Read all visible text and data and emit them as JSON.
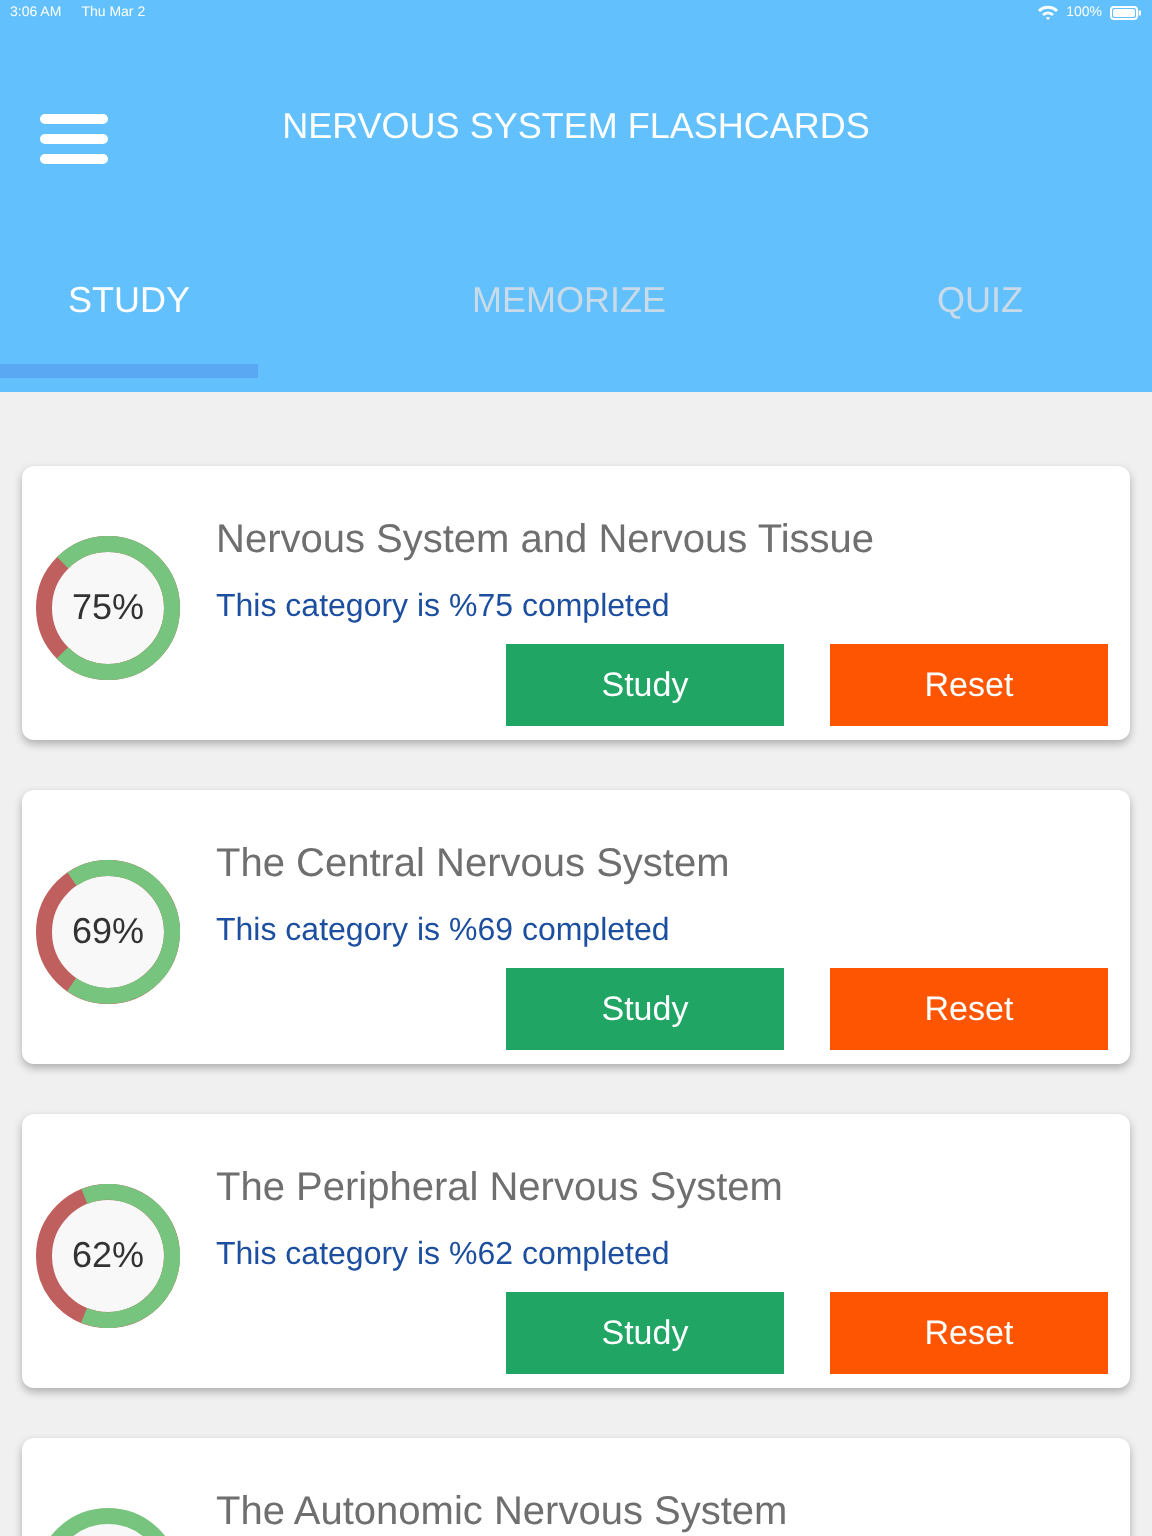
{
  "status_bar": {
    "time": "3:06 AM",
    "date": "Thu Mar 2",
    "battery": "100%"
  },
  "header": {
    "title": "NERVOUS SYSTEM FLASHCARDS"
  },
  "tabs": [
    {
      "label": "STUDY",
      "selected": true
    },
    {
      "label": "MEMORIZE",
      "selected": false
    },
    {
      "label": "QUIZ",
      "selected": false
    }
  ],
  "categories": [
    {
      "title": "Nervous System and Nervous Tissue",
      "percent": "75%",
      "level": 0.75,
      "subtitle": "This category is %75 completed",
      "buttons": [
        "Study",
        "Reset"
      ]
    },
    {
      "title": "The Central Nervous System",
      "percent": "69%",
      "level": 0.69,
      "subtitle": "This category is %69 completed",
      "buttons": [
        "Study",
        "Reset"
      ]
    },
    {
      "title": "The Peripheral Nervous System",
      "percent": "62%",
      "level": 0.62,
      "subtitle": "This category is %62 completed",
      "buttons": [
        "Study",
        "Reset"
      ]
    },
    {
      "title": "The Autonomic Nervous System"
    }
  ]
}
